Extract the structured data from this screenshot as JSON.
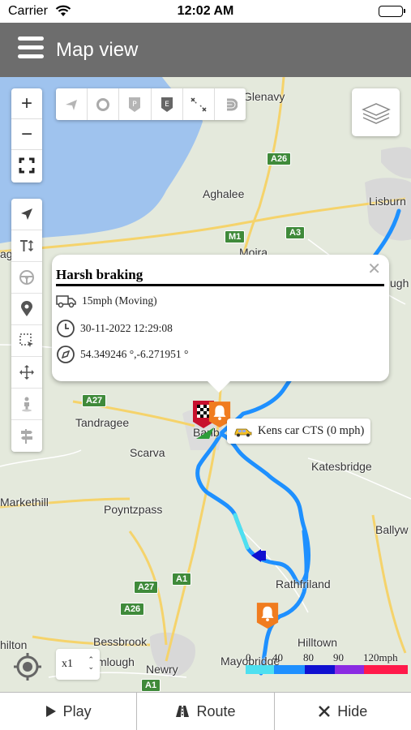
{
  "status_bar": {
    "carrier": "Carrier",
    "time": "12:02 AM"
  },
  "header": {
    "title": "Map view"
  },
  "map": {
    "places": {
      "glenavy": "Glenavy",
      "aghalee": "Aghalee",
      "lisburn": "Lisburn",
      "moira": "Moira",
      "ugh": "ugh",
      "tandragee": "Tandragee",
      "scarva": "Scarva",
      "banbridge": "Banb",
      "katesbridge": "Katesbridge",
      "markethill": "Markethill",
      "poyntzpass": "Poyntzpass",
      "ballyw": "Ballyw",
      "rathfriland": "Rathfriland",
      "bessbrook": "Bessbrook",
      "hilltown": "Hilltown",
      "camlough": "mlough",
      "newry": "Newry",
      "mayobridge": "Mayobridge",
      "hilton": "hilton",
      "lough": "Lough",
      "lag": "ag"
    },
    "roads": {
      "a26": "A26",
      "m1": "M1",
      "a3": "A3",
      "a27_north": "A27",
      "a27_south": "A27",
      "a26_south": "A26",
      "a1_mid": "A1",
      "a1_south": "A1"
    }
  },
  "controls": {
    "zoom_in": "+",
    "zoom_out": "−"
  },
  "popup": {
    "title": "Harsh braking",
    "speed": "15mph (Moving)",
    "datetime": "30-11-2022 12:29:08",
    "coordinates": "54.349246 °,-6.271951 °"
  },
  "vehicle_label": "Kens car CTS (0 mph)",
  "playback_speed": "x1",
  "legend": {
    "labels": [
      "0",
      "40",
      "80",
      "90",
      "120mph"
    ],
    "colors": [
      "#4ee0f0",
      "#1e90ff",
      "#1010d0",
      "#8a2be2",
      "#ff1a4a"
    ]
  },
  "bottom_bar": {
    "play_label": "Play",
    "route_label": "Route",
    "hide_label": "Hide"
  },
  "colors": {
    "header_bg": "#6d6d6d",
    "route_blue": "#1e90ff",
    "event_orange": "#f07c1f"
  }
}
